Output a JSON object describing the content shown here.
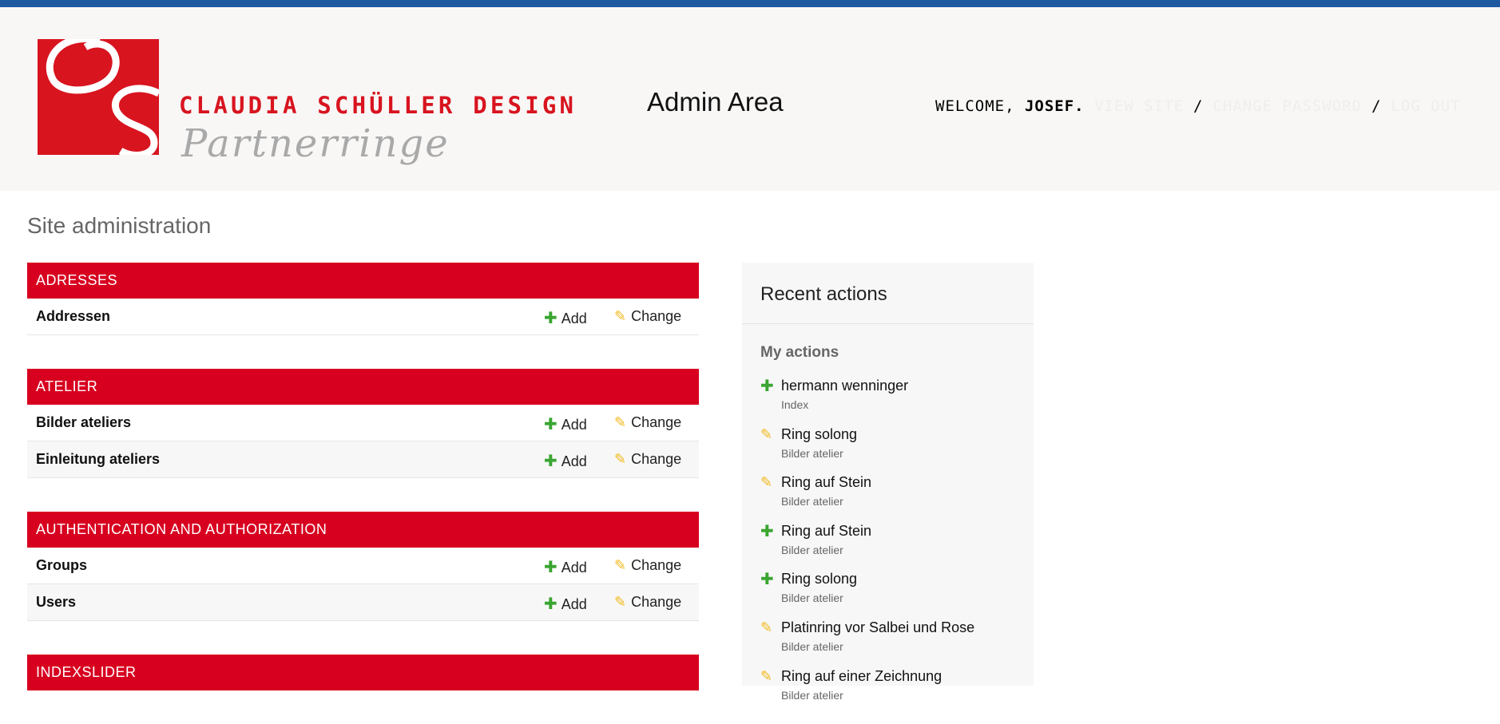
{
  "branding": {
    "logo_name": "CLAUDIA SCHÜLLER DESIGN",
    "logo_sub": "Partnerringe",
    "area_title": "Admin Area",
    "colors": {
      "brand_red": "#d7001f",
      "top_bar": "#1f5aa1",
      "add_green": "#3aa530",
      "change_yellow": "#f2b91a"
    }
  },
  "user_tools": {
    "welcome": "WELCOME, ",
    "username": "JOSEF",
    "view_site": "VIEW SITE",
    "change_password": "CHANGE PASSWORD",
    "logout": "LOG OUT",
    "separator": "/"
  },
  "page": {
    "title": "Site administration"
  },
  "modules": [
    {
      "name": "ADRESSES",
      "models": [
        {
          "name": "Addressen",
          "add": "Add",
          "change": "Change"
        }
      ]
    },
    {
      "name": "ATELIER",
      "models": [
        {
          "name": "Bilder ateliers",
          "add": "Add",
          "change": "Change"
        },
        {
          "name": "Einleitung ateliers",
          "add": "Add",
          "change": "Change"
        }
      ]
    },
    {
      "name": "AUTHENTICATION AND AUTHORIZATION",
      "models": [
        {
          "name": "Groups",
          "add": "Add",
          "change": "Change"
        },
        {
          "name": "Users",
          "add": "Add",
          "change": "Change"
        }
      ]
    },
    {
      "name": "INDEXSLIDER",
      "models": []
    }
  ],
  "recent_actions": {
    "title": "Recent actions",
    "my_actions_label": "My actions",
    "items": [
      {
        "icon": "add",
        "title": "hermann wenninger",
        "type": "Index"
      },
      {
        "icon": "change",
        "title": "Ring solong",
        "type": "Bilder atelier"
      },
      {
        "icon": "change",
        "title": "Ring auf Stein",
        "type": "Bilder atelier"
      },
      {
        "icon": "add",
        "title": "Ring auf Stein",
        "type": "Bilder atelier"
      },
      {
        "icon": "add",
        "title": "Ring solong",
        "type": "Bilder atelier"
      },
      {
        "icon": "change",
        "title": "Platinring vor Salbei und Rose",
        "type": "Bilder atelier"
      },
      {
        "icon": "change",
        "title": "Ring auf einer Zeichnung",
        "type": "Bilder atelier"
      }
    ]
  }
}
